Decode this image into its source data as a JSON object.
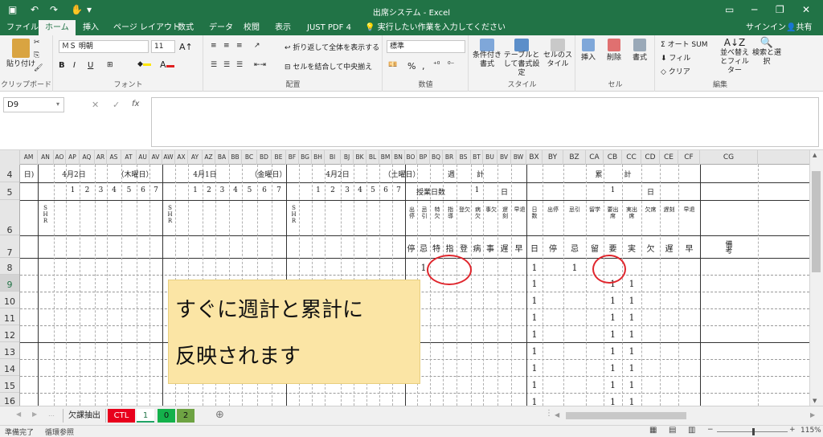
{
  "window": {
    "title": "出席システム - Excel",
    "signin": "サインイン",
    "share": "共有"
  },
  "tabs": [
    "ファイル",
    "ホーム",
    "挿入",
    "ページ レイアウト",
    "数式",
    "データ",
    "校閲",
    "表示",
    "JUST PDF 4"
  ],
  "tell_me": "実行したい作業を入力してください",
  "ribbon": {
    "paste": "貼り付け",
    "clipboard": "クリップボード",
    "font_name": "ＭＳ 明朝",
    "font_size": "11",
    "bold": "B",
    "italic": "I",
    "underline": "U",
    "font_group": "フォント",
    "wrap": "折り返して全体を表示する",
    "merge": "セルを結合して中央揃え",
    "align_group": "配置",
    "number_format": "標準",
    "number_group": "数値",
    "cond_fmt": "条件付き書式",
    "table_fmt": "テーブルとして書式設定",
    "cell_style": "セルのスタイル",
    "style_group": "スタイル",
    "insert": "挿入",
    "delete": "削除",
    "format": "書式",
    "cells_group": "セル",
    "autosum": "オート SUM",
    "fill": "フィル",
    "clear": "クリア",
    "sort": "並べ替えとフィルター",
    "find": "検索と選択",
    "edit_group": "編集"
  },
  "formula": {
    "namebox": "D9",
    "fx": "fx",
    "value": ""
  },
  "colors": {
    "excel_green": "#217346",
    "callout": "#fbe5a5",
    "circle": "#e0262d"
  },
  "columns": [
    "AM",
    "AN",
    "AO",
    "AP",
    "AQ",
    "AR",
    "AS",
    "AT",
    "AU",
    "AV",
    "AW",
    "AX",
    "AY",
    "AZ",
    "BA",
    "BB",
    "BC",
    "BD",
    "BE",
    "BF",
    "BG",
    "BH",
    "BI",
    "BJ",
    "BK",
    "BL",
    "BM",
    "BN",
    "BO",
    "BP",
    "BQ",
    "BR",
    "BS",
    "BT",
    "BU",
    "BV",
    "BW",
    "BX",
    "BY",
    "BZ",
    "CA",
    "CB",
    "CC",
    "CD",
    "CE",
    "CF",
    "CG"
  ],
  "rows": [
    "4",
    "5",
    "6",
    "7",
    "8",
    "9",
    "10",
    "11",
    "12",
    "13",
    "14",
    "15",
    "16"
  ],
  "sheet": {
    "r4": {
      "d1_end": "日)",
      "d1": "4月2日",
      "d1_week": "（木曜日）",
      "d2": "4月1日",
      "d2_week": "（金曜日）",
      "d3": "4月2日",
      "d3_week": "（土曜日）",
      "weekly": "週　　　計",
      "cumul": "累　　　計"
    },
    "periods": [
      "1",
      "2",
      "3",
      "4",
      "5",
      "6",
      "7"
    ],
    "shr": "SHR",
    "r5": {
      "lesson_days": "授業日数",
      "w_days": "1",
      "w_unit": "日",
      "c_days": "1",
      "c_unit": "日"
    },
    "r6_weekly": [
      "出停",
      "忌引",
      "特欠",
      "指導",
      "登欠",
      "病欠",
      "事欠",
      "遅刻",
      "早退"
    ],
    "r6_cumul": [
      "日数",
      "出停",
      "忌引",
      "留学",
      "要出席",
      "実出席",
      "欠席",
      "遅刻",
      "早退"
    ],
    "r7_weekly": [
      "停",
      "忌",
      "特",
      "指",
      "登",
      "病",
      "事",
      "遅",
      "早"
    ],
    "r7_cumul": [
      "日",
      "停",
      "忌",
      "留",
      "要",
      "実",
      "欠",
      "遅",
      "早"
    ],
    "remarks": "備考",
    "r8": {
      "w_kibiki": "1",
      "c_days": "1",
      "c_kibiki": "1"
    },
    "r_days": "1",
    "r_req": "1",
    "r_act": "1"
  },
  "callout": {
    "line1": "すぐに週計と累計に",
    "line2": "反映されます"
  },
  "sheet_tabs": [
    "欠課抽出",
    "CTL",
    "1",
    "0",
    "2"
  ],
  "status": {
    "ready": "準備完了",
    "circular": "循環参照",
    "zoom": "115%"
  }
}
